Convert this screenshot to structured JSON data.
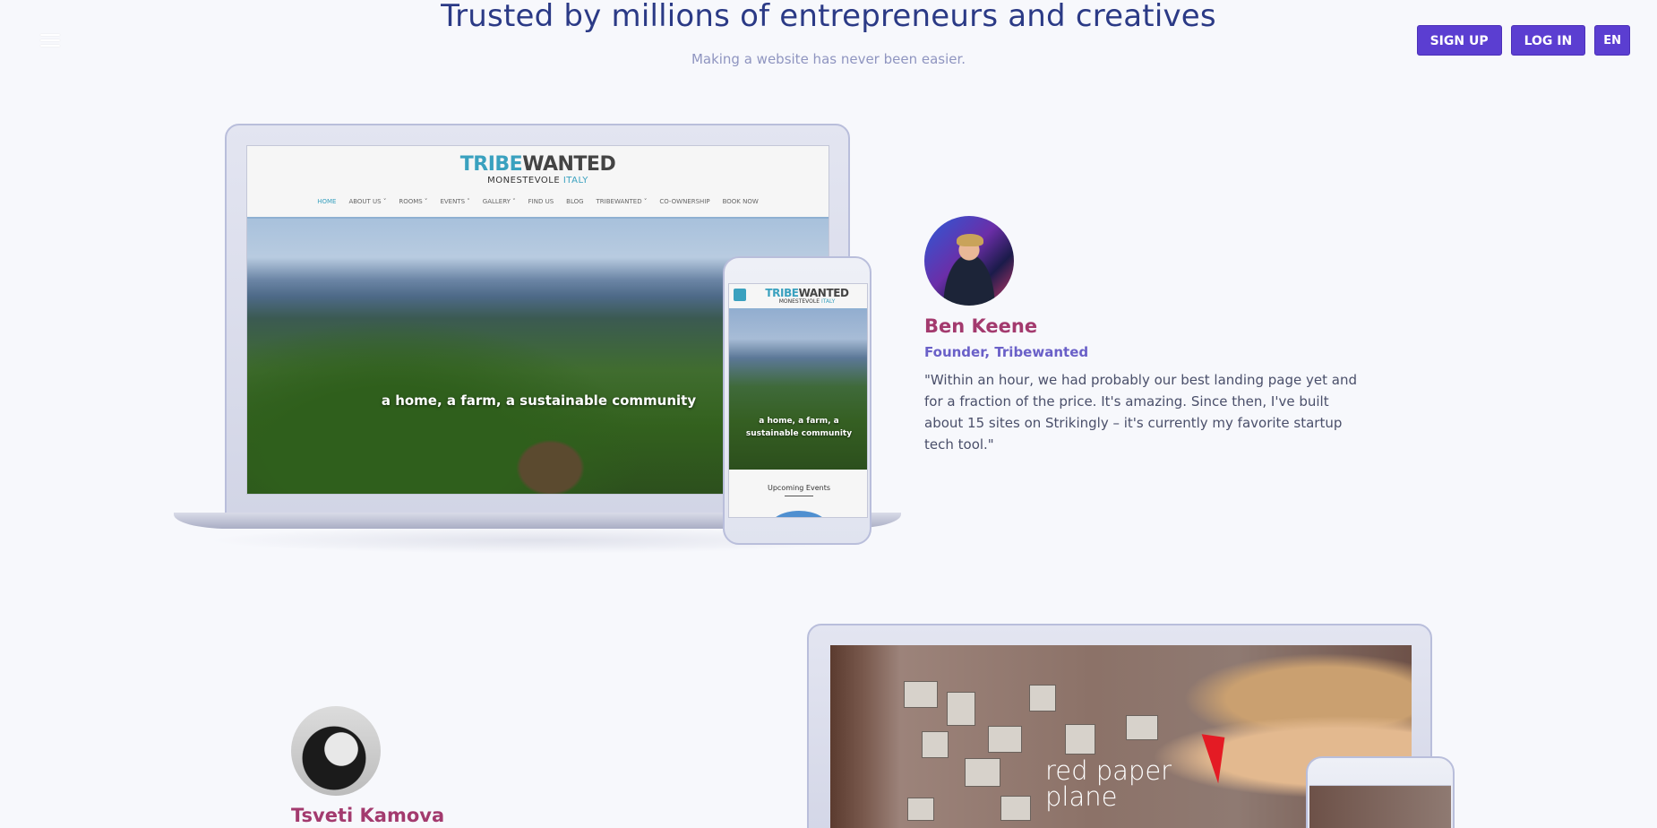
{
  "header": {
    "title": "Trusted by millions of entrepreneurs and creatives",
    "subtitle": "Making a website has never been easier.",
    "signup_label": "SIGN UP",
    "login_label": "LOG IN",
    "lang_label": "EN"
  },
  "showcase1": {
    "site": {
      "logo_part1": "TRIBE",
      "logo_part2": "WANTED",
      "logo_sub_part1": "MONESTEVOLE",
      "logo_sub_part2": "ITALY",
      "nav": [
        "HOME",
        "ABOUT US ˅",
        "ROOMS ˅",
        "EVENTS ˅",
        "GALLERY ˅",
        "FIND US",
        "BLOG",
        "TRIBEWANTED ˅",
        "CO-OWNERSHIP",
        "BOOK NOW"
      ],
      "hero_text": "a home, a farm, a sustainable community",
      "mobile_section": "Upcoming Events"
    },
    "testimonial": {
      "name": "Ben Keene",
      "role": "Founder, Tribewanted",
      "quote": "\"Within an hour, we had probably our best landing page yet and for a fraction of the price. It's amazing. Since then, I've built about 15 sites on Strikingly – it's currently my favorite startup tech tool.\""
    }
  },
  "showcase2": {
    "testimonial": {
      "name": "Tsveti Kamova"
    },
    "site": {
      "brand_line1": "red paper",
      "brand_line2": "plane"
    }
  },
  "colors": {
    "accent": "#5b3ed1",
    "headline": "#2b3a86",
    "name": "#a33a6e",
    "role": "#6a60c8",
    "brand_teal": "#3aa1bf",
    "brand_red": "#e41b24"
  }
}
